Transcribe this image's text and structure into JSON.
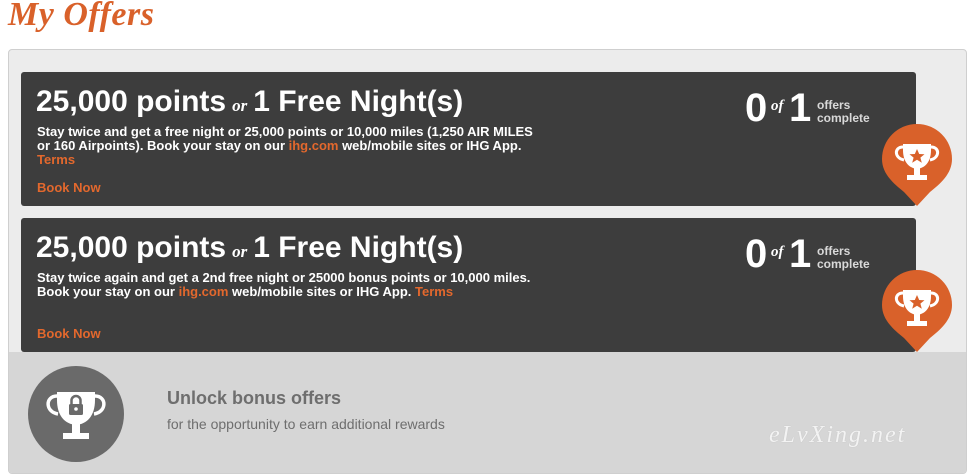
{
  "page": {
    "title": "My Offers"
  },
  "offers": [
    {
      "points": "25,000 points",
      "or": "or",
      "reward": "1 Free Night(s)",
      "desc_pre": "Stay twice and get a free night or 25,000 points or 10,000 miles (1,250 AIR MILES or 160 Airpoints). Book your stay on our ",
      "desc_link": "ihg.com",
      "desc_post": " web/mobile sites or IHG App. ",
      "terms": "Terms",
      "book_now": "Book Now",
      "progress": {
        "completed": "0",
        "of": "of",
        "total": "1",
        "label_1": "offers",
        "label_2": "complete"
      },
      "badge_icon": "trophy-star-icon"
    },
    {
      "points": "25,000 points",
      "or": "or",
      "reward": "1 Free Night(s)",
      "desc_pre": "Stay twice again and get a 2nd free night or 25000 bonus points or 10,000 miles. Book your stay on our ",
      "desc_link": "ihg.com",
      "desc_post": " web/mobile sites or IHG App. ",
      "terms": "Terms",
      "book_now": "Book Now",
      "progress": {
        "completed": "0",
        "of": "of",
        "total": "1",
        "label_1": "offers",
        "label_2": "complete"
      },
      "badge_icon": "trophy-star-icon"
    }
  ],
  "locked": {
    "icon": "locked-trophy-icon",
    "title": "Unlock bonus offers",
    "subtitle": "for the opportunity to earn additional rewards"
  },
  "watermark": "eLvXing.net",
  "colors": {
    "accent": "#e3682d",
    "card_bg": "#3d3d3d",
    "panel_bg": "#ececec",
    "locked_bg": "#d6d6d6"
  }
}
